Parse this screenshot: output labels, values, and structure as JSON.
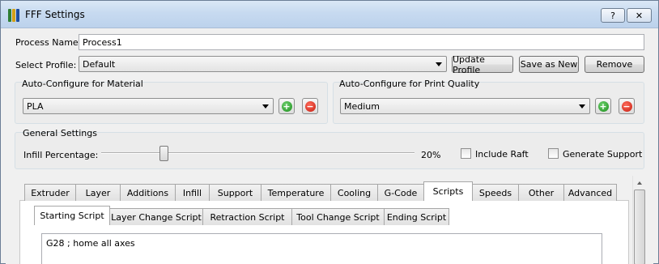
{
  "window": {
    "title": "FFF Settings",
    "help_label": "?",
    "close_label": "✕",
    "icon": "app-icon"
  },
  "process": {
    "label": "Process Name:",
    "value": "Process1"
  },
  "profile": {
    "label": "Select Profile:",
    "selected": "Default",
    "update_label": "Update Profile",
    "save_as_new_label": "Save as New",
    "remove_label": "Remove"
  },
  "material": {
    "title": "Auto-Configure for Material",
    "selected": "PLA"
  },
  "quality": {
    "title": "Auto-Configure for Print Quality",
    "selected": "Medium"
  },
  "general": {
    "title": "General Settings",
    "infill_label": "Infill Percentage:",
    "infill_value": "20%",
    "infill_fraction": 0.2,
    "include_raft_label": "Include Raft",
    "include_raft_checked": false,
    "generate_support_label": "Generate Support",
    "generate_support_checked": false
  },
  "tabs": [
    "Extruder",
    "Layer",
    "Additions",
    "Infill",
    "Support",
    "Temperature",
    "Cooling",
    "G-Code",
    "Scripts",
    "Speeds",
    "Other",
    "Advanced"
  ],
  "active_tab": "Scripts",
  "script_tabs": [
    "Starting Script",
    "Layer Change Script",
    "Retraction Script",
    "Tool Change Script",
    "Ending Script"
  ],
  "active_script_tab": "Starting Script",
  "script_content": "G28 ; home all axes",
  "colors": {
    "titlebar": "#c7daf0",
    "plus_icon": "#1b8d1b",
    "minus_icon": "#c51d10"
  }
}
